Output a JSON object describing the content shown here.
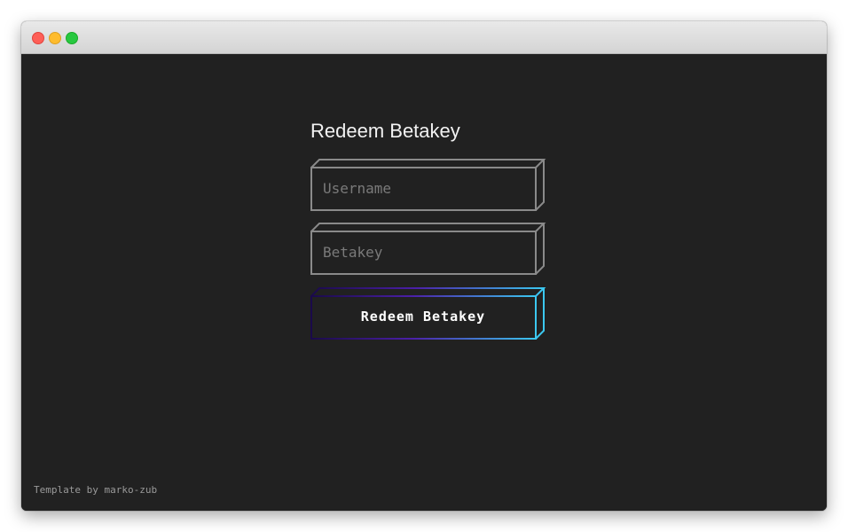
{
  "window": {
    "controls": [
      "close",
      "minimize",
      "maximize"
    ]
  },
  "form": {
    "title": "Redeem Betakey",
    "username_placeholder": "Username",
    "username_value": "",
    "betakey_placeholder": "Betakey",
    "betakey_value": "",
    "submit_label": "Redeem Betakey"
  },
  "footer": {
    "credit": "Template by marko-zub"
  },
  "colors": {
    "background": "#212121",
    "input_border": "#8a8a8a",
    "gradient_start": "#1a0a4a",
    "gradient_mid": "#4b1fa8",
    "gradient_end": "#3bc8f0"
  }
}
